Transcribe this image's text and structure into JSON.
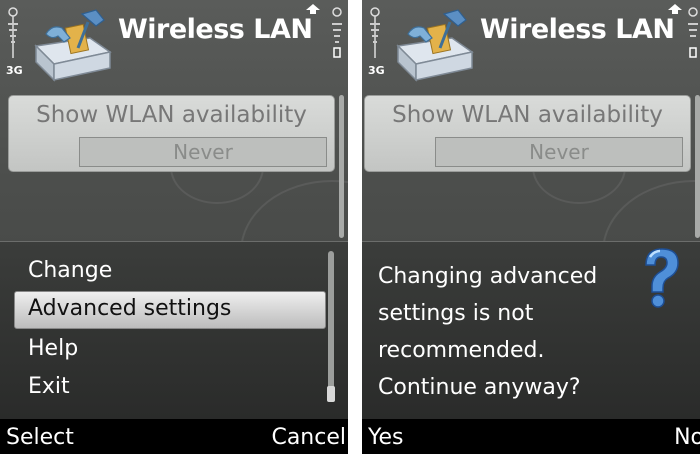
{
  "screens": [
    {
      "app_title": "Wireless LAN",
      "network_label": "3G",
      "field_label": "Show WLAN availability",
      "field_value": "Never",
      "menu_items": [
        "Change",
        "Advanced settings",
        "Help",
        "Exit"
      ],
      "selected_item": "Advanced settings",
      "softkey_left": "Select",
      "softkey_right": "Cancel"
    },
    {
      "app_title": "Wireless LAN",
      "network_label": "3G",
      "field_label": "Show WLAN availability",
      "field_value": "Never",
      "query_text": "Changing advanced settings is not recommended. Continue anyway?",
      "query_icon": "question-mark-icon",
      "softkey_left": "Yes",
      "softkey_right": "No"
    }
  ],
  "icons": {
    "app": "wlan-toolbox-icon",
    "signal": "signal-strength-icon",
    "battery": "battery-icon",
    "upload": "data-transfer-icon"
  },
  "colors": {
    "background": "#4a4c4a",
    "popup": "#2f302f",
    "highlight": "#e0e0e0",
    "softkey_bar": "#000000",
    "text": "#ffffff"
  }
}
